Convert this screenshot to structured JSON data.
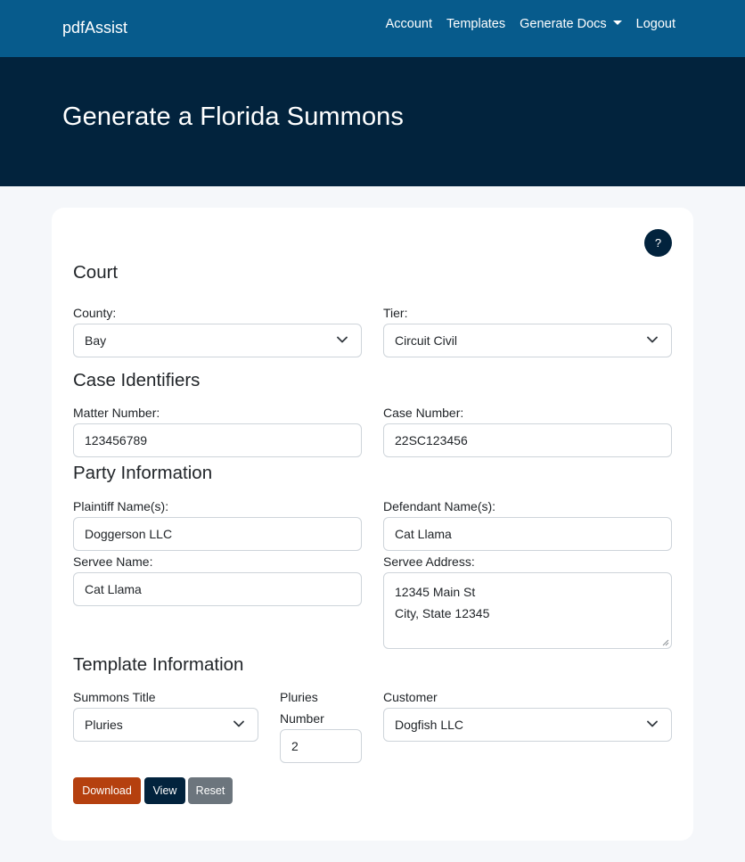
{
  "nav": {
    "brand": "pdfAssist",
    "links": [
      "Account",
      "Templates",
      "Generate Docs",
      "Logout"
    ]
  },
  "hero": {
    "title": "Generate a Florida Summons"
  },
  "help": {
    "label": "?"
  },
  "court": {
    "title": "Court",
    "county_label": "County:",
    "county_value": "Bay",
    "tier_label": "Tier:",
    "tier_value": "Circuit Civil"
  },
  "case": {
    "title": "Case Identifiers",
    "matter_label": "Matter Number:",
    "matter_value": "123456789",
    "case_label": "Case Number:",
    "case_value": "22SC123456"
  },
  "party": {
    "title": "Party Information",
    "plaintiff_label": "Plaintiff Name(s):",
    "plaintiff_value": "Doggerson LLC",
    "defendant_label": "Defendant Name(s):",
    "defendant_value": "Cat Llama",
    "servee_label": "Servee Name:",
    "servee_value": "Cat Llama",
    "address_label": "Servee Address:",
    "address_line1": "12345 Main St",
    "address_line2": "City, State 12345"
  },
  "template": {
    "title": "Template Information",
    "summons_label": "Summons Title",
    "summons_value": "Pluries",
    "pluries_label_line1": "Pluries",
    "pluries_label_line2": "Number",
    "pluries_value": "2",
    "customer_label": "Customer",
    "customer_value": "Dogfish LLC"
  },
  "actions": {
    "download": "Download",
    "view": "View",
    "reset": "Reset"
  },
  "colors": {
    "navbar": "#075b8c",
    "hero": "#02233d",
    "download": "#b5400f",
    "view": "#02233d",
    "reset": "#6c757d"
  }
}
